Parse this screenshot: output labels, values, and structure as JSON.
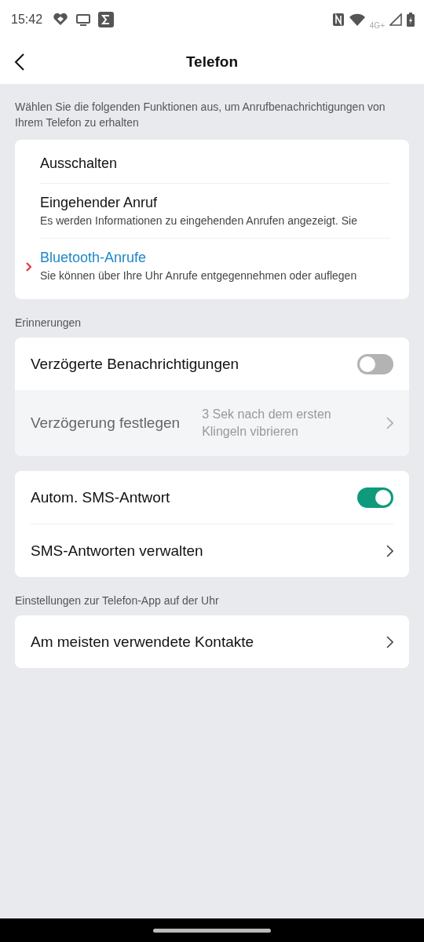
{
  "status_bar": {
    "time": "15:42",
    "network": "4G+"
  },
  "header": {
    "title": "Telefon"
  },
  "intro": "Wählen Sie die folgenden Funktionen aus, um Anrufbenachrichtigungen von Ihrem Telefon zu erhalten",
  "call_options": [
    {
      "label": "Ausschalten",
      "selected": false
    },
    {
      "label": "Eingehender Anruf",
      "description": "Es werden Informationen zu eingehenden Anrufen angezeigt. Sie",
      "selected": false
    },
    {
      "label": "Bluetooth-Anrufe",
      "description": "Sie können über Ihre Uhr Anrufe entgegennehmen oder auflegen",
      "selected": true
    }
  ],
  "sections": [
    {
      "cards": [
        [
          {
            "kind": "toggle",
            "label": "Verzögerte Benachrichtigungen",
            "on": false,
            "disabled": false
          },
          {
            "kind": "link",
            "label": "Verzögerung festlegen",
            "value": "3 Sek nach dem ersten Klingeln vibrieren",
            "disabled": true
          }
        ]
      ],
      "title": "Erinnerungen"
    },
    {
      "cards": [
        [
          {
            "kind": "toggle",
            "label": "Autom. SMS-Antwort",
            "on": true,
            "disabled": false
          },
          {
            "kind": "link",
            "label": "SMS-Antworten verwalten",
            "disabled": false
          }
        ]
      ]
    },
    {
      "title": "Einstellungen zur Telefon-App auf der Uhr",
      "cards": [
        [
          {
            "kind": "link",
            "label": "Am meisten verwendete Kontakte",
            "disabled": false
          }
        ]
      ]
    }
  ]
}
